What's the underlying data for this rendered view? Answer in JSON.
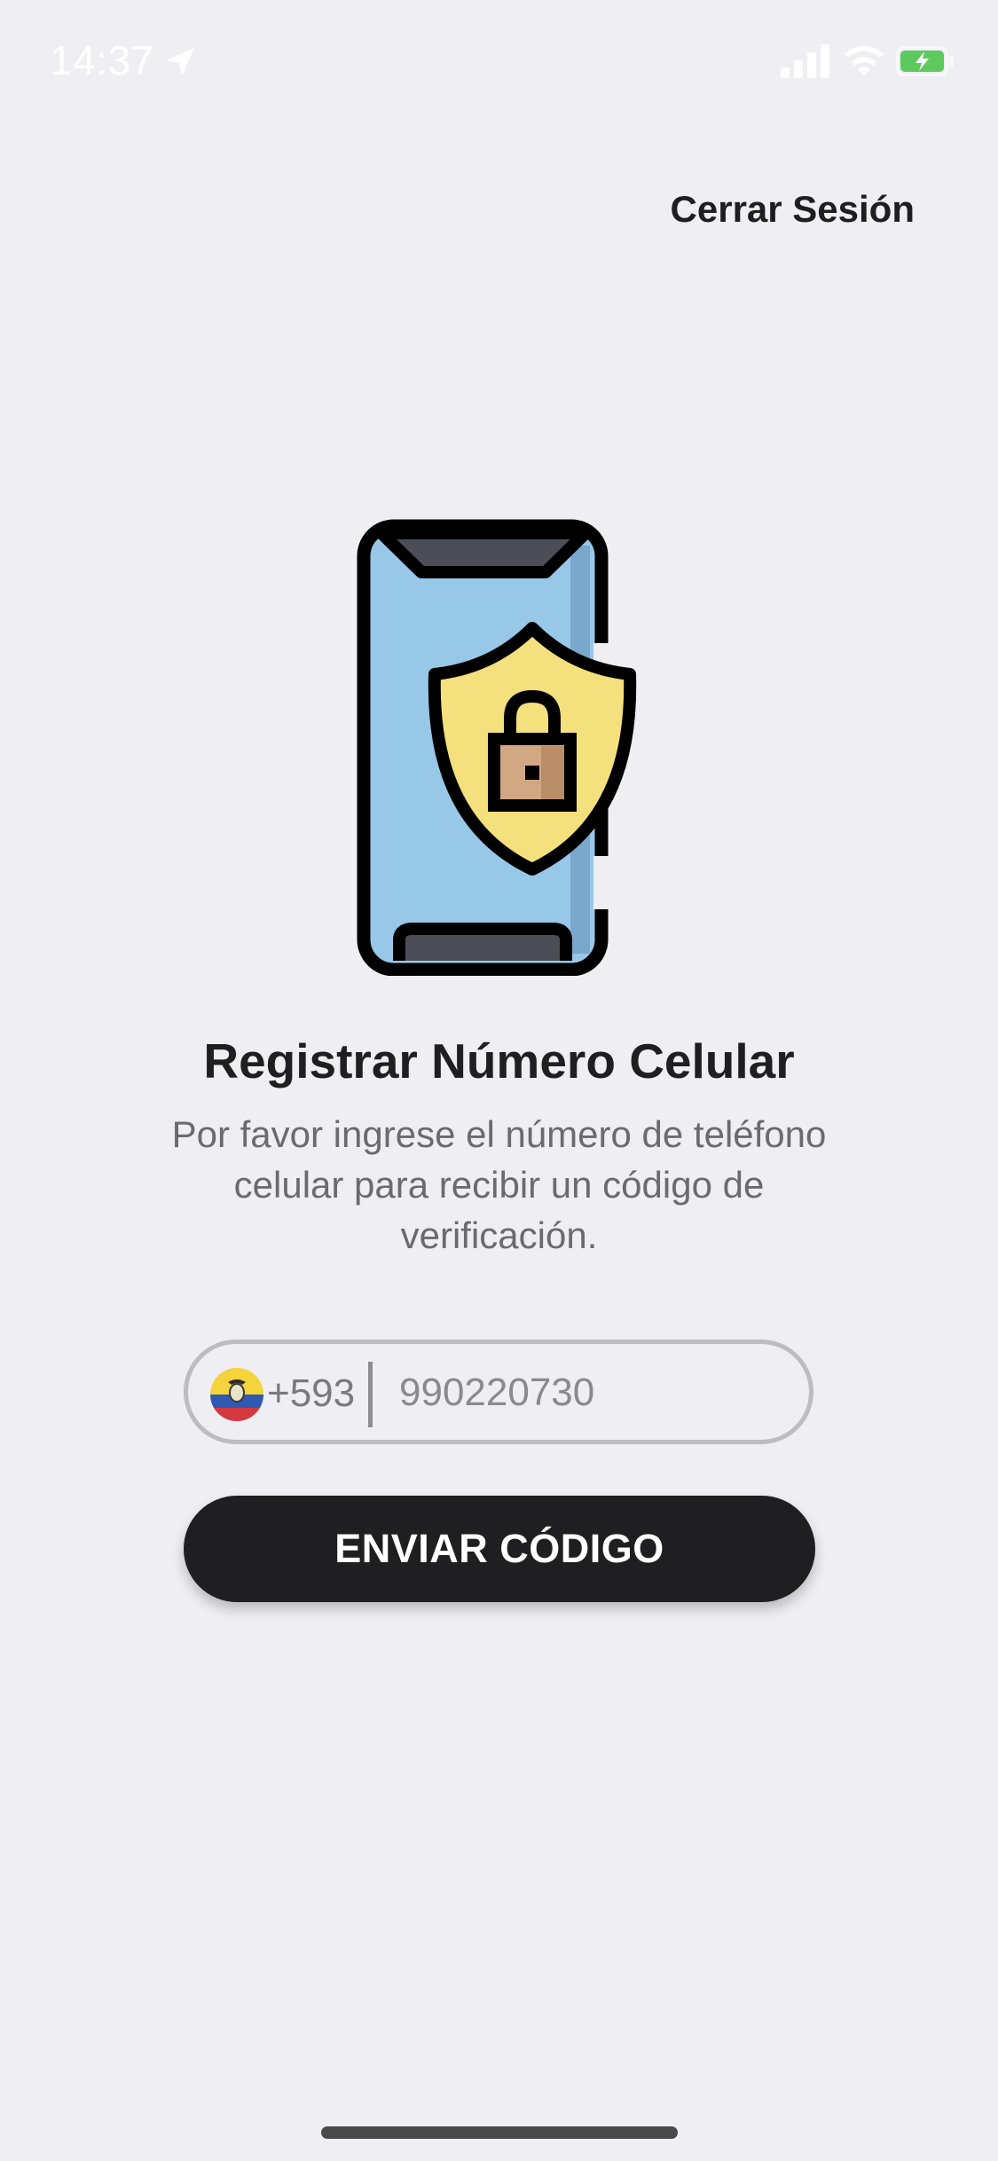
{
  "status_bar": {
    "time": "14:37",
    "icons": [
      "location-arrow-icon",
      "cellular-signal-icon",
      "wifi-icon",
      "battery-charging-icon"
    ]
  },
  "header": {
    "logout_label": "Cerrar Sesión"
  },
  "illustration": {
    "icon": "phone-security-lock-icon"
  },
  "main": {
    "title": "Registrar Número Celular",
    "description": "Por favor ingrese el número de teléfono celular para recibir un código de verificación."
  },
  "phone_form": {
    "country_flag": "ecuador-flag-icon",
    "country_code": "+593",
    "phone_value": "",
    "phone_placeholder": "990220730"
  },
  "actions": {
    "send_label": "ENVIAR CÓDIGO"
  },
  "colors": {
    "background": "#efeef3",
    "button": "#1f1e20",
    "phone_screen": "#98c8e8",
    "shield": "#f4e07c"
  }
}
